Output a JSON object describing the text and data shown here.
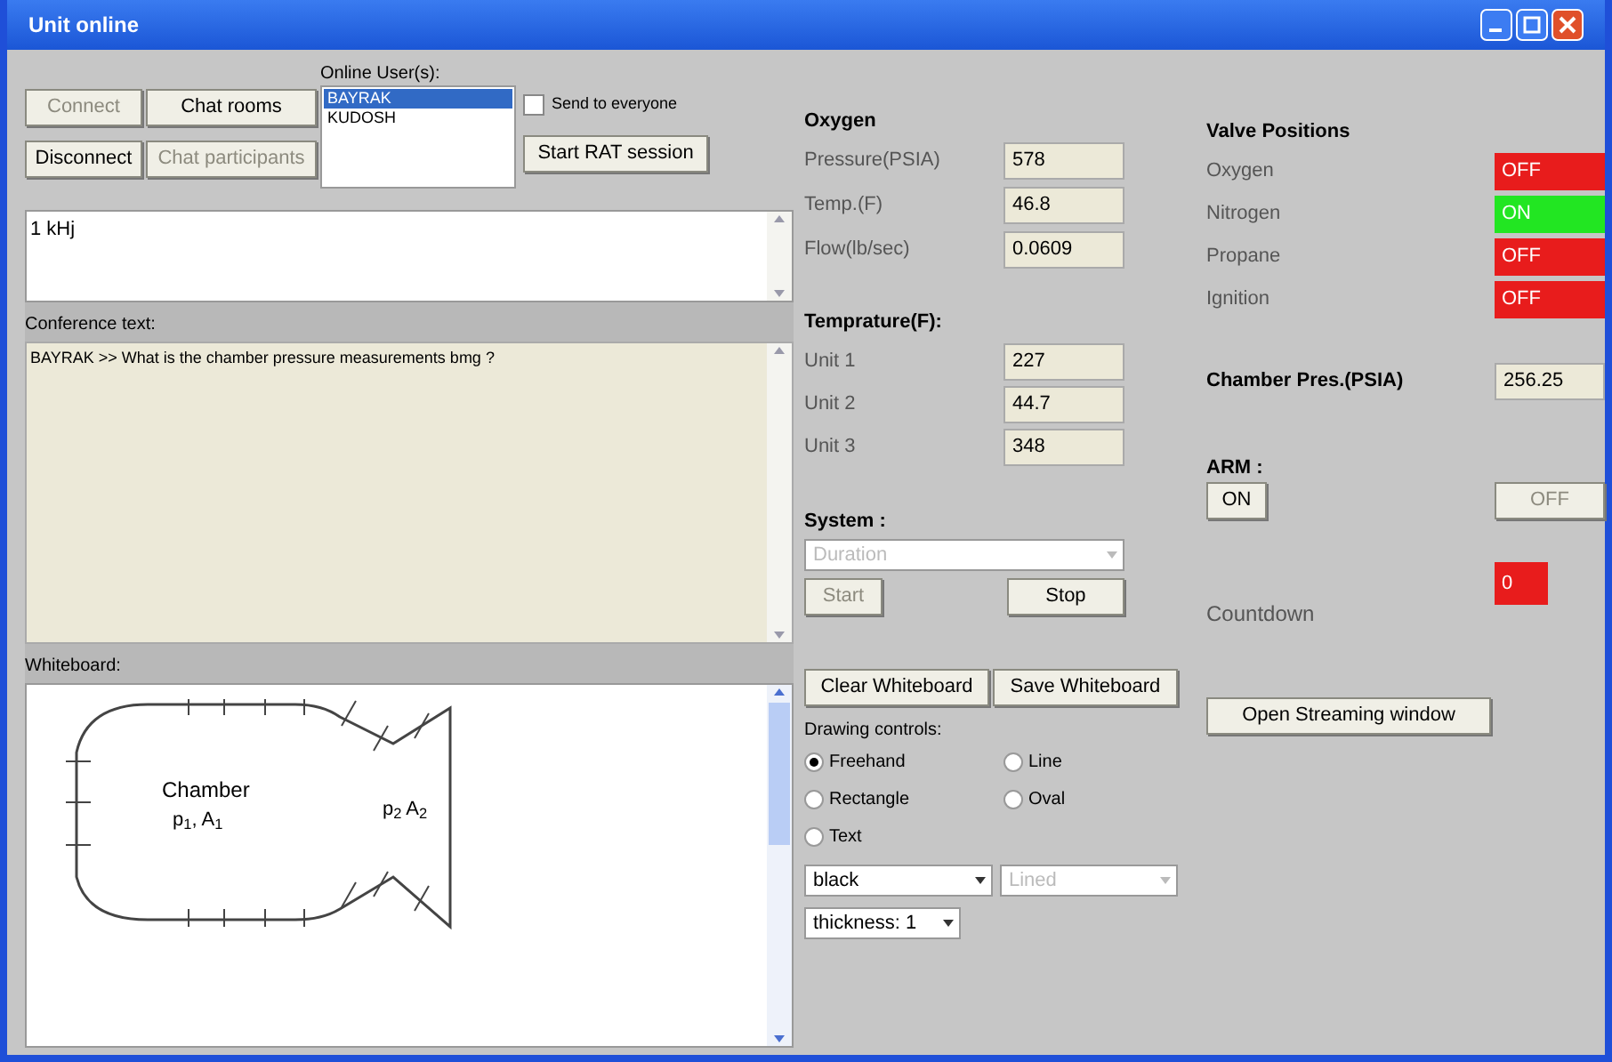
{
  "window": {
    "title": "Unit online"
  },
  "chat": {
    "buttons": [
      {
        "label": "Connect",
        "disabled": true
      },
      {
        "label": "Chat rooms",
        "disabled": false
      },
      {
        "label": "Disconnect",
        "disabled": false
      },
      {
        "label": "Chat participants",
        "disabled": true
      }
    ],
    "online_users_label": "Online User(s):",
    "online_users": [
      {
        "name": "BAYRAK",
        "selected": true
      },
      {
        "name": "KUDOSH",
        "selected": false
      }
    ],
    "send_to_everyone": {
      "label": "Send to everyone",
      "checked": false
    },
    "session_button": "Start RAT session",
    "message": "1 kHj",
    "conference_label": "Conference text:",
    "conference_lines": [
      "BAYRAK >> What is the chamber pressure measurements bmg ?"
    ],
    "whiteboard_label": "Whiteboard:",
    "whiteboard_texts": [
      "Chamber",
      "p$_{1}$, A$_{1}$",
      "p$_{2}$ A$_{2}$"
    ]
  },
  "oxygen": {
    "title": "Oxygen",
    "rows": [
      {
        "label": "Pressure(PSIA)",
        "value": "578"
      },
      {
        "label": "Temp.(F)",
        "value": "46.8"
      },
      {
        "label": "Flow(lb/sec)",
        "value": "0.0609"
      }
    ]
  },
  "temperature": {
    "title": "Temprature(F):",
    "rows": [
      {
        "label": "Unit 1",
        "value": "227"
      },
      {
        "label": "Unit 2",
        "value": "44.7"
      },
      {
        "label": "Unit 3",
        "value": "348"
      }
    ]
  },
  "system": {
    "title": "System :",
    "select": {
      "value": "Duration",
      "disabled": true
    },
    "buttons": [
      {
        "label": "Start",
        "disabled": true
      },
      {
        "label": "Stop",
        "disabled": false
      }
    ]
  },
  "valves": {
    "title": "Valve Positions",
    "items": [
      {
        "name": "Oxygen",
        "on": false,
        "state": "OFF"
      },
      {
        "name": "Nitrogen",
        "on": true,
        "state": "ON"
      },
      {
        "name": "Propane",
        "on": false,
        "state": "OFF"
      },
      {
        "name": "Ignition",
        "on": false,
        "state": "OFF"
      }
    ]
  },
  "chamber": {
    "label": "Chamber Pres.(PSIA)",
    "value": "256.25"
  },
  "arm": {
    "title": "ARM :",
    "buttons": [
      {
        "label": "ON",
        "disabled": false
      },
      {
        "label": "OFF",
        "disabled": true
      }
    ]
  },
  "countdown": {
    "label": "Countdown",
    "value": "0"
  },
  "whiteboard_buttons": [
    {
      "label": "Clear Whiteboard"
    },
    {
      "label": "Save Whiteboard"
    }
  ],
  "streaming_button": "Open Streaming window",
  "drawing": {
    "title": "Drawing controls:",
    "tools": [
      {
        "label": "Freehand",
        "selected": true
      },
      {
        "label": "Line",
        "selected": false
      },
      {
        "label": "Rectangle",
        "selected": false
      },
      {
        "label": "Oval",
        "selected": false
      },
      {
        "label": "Text",
        "selected": false
      }
    ],
    "color_select": {
      "value": "black",
      "disabled": false
    },
    "fill_select": {
      "value": "Lined",
      "disabled": true
    },
    "thickness_select": {
      "value": "thickness: 1",
      "disabled": false
    }
  }
}
